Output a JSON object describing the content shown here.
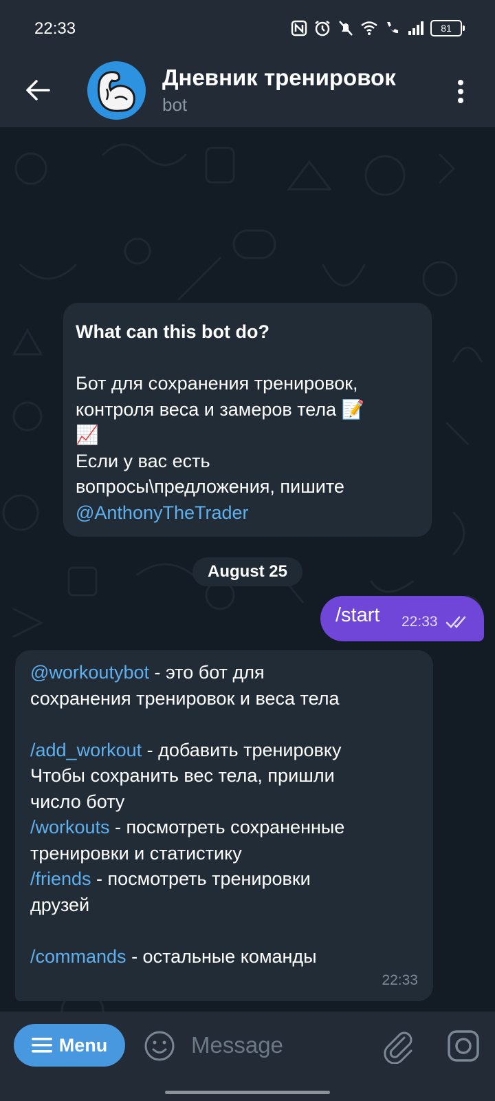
{
  "status_bar": {
    "time": "22:33",
    "battery": "81",
    "icons": [
      "nfc-icon",
      "alarm-icon",
      "mute-icon",
      "wifi-icon",
      "wifi-call-icon",
      "signal-icon",
      "battery-icon"
    ]
  },
  "header": {
    "title": "Дневник тренировок",
    "subtitle": "bot",
    "avatar_icon": "muscle-arm-icon"
  },
  "intro": {
    "title": "What can this bot do?",
    "line1": "Бот для сохранения тренировок,",
    "line2": "контроля веса и замеров тела 📝",
    "line3": "📈",
    "line4": "Если у вас есть",
    "line5": "вопросы\\предложения, пишите",
    "link": "@AnthonyTheTrader"
  },
  "date_separator": "August 25",
  "outgoing": {
    "text": "/start",
    "time": "22:33"
  },
  "incoming": {
    "l1_link": "@workoutybot",
    "l1_text": " - это бот для",
    "l2": "сохранения тренировок и веса тела",
    "l3_link": "/add_workout",
    "l3_text": " - добавить тренировку",
    "l4": "Чтобы сохранить вес тела, пришли",
    "l5": "число боту",
    "l6_link": "/workouts",
    "l6_text": " - посмотреть сохраненные",
    "l7": "тренировки и статистику",
    "l8_link": "/friends",
    "l8_text": " - посмотреть тренировки",
    "l9": "друзей",
    "l10_link": "/commands",
    "l10_text": " - остальные команды",
    "time": "22:33"
  },
  "input_bar": {
    "menu_label": "Menu",
    "placeholder": "Message"
  },
  "colors": {
    "accent_link": "#5fb0ee",
    "outgoing_bubble": "#6f46d8",
    "menu_button": "#4798de",
    "bubble": "#222c37"
  }
}
